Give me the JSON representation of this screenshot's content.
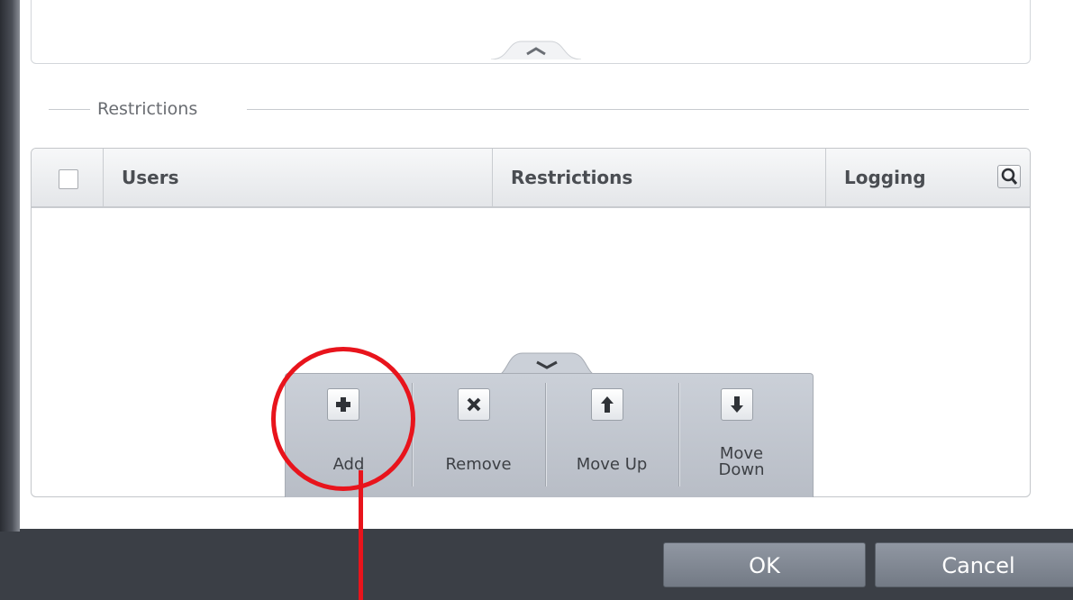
{
  "section": {
    "label": "Restrictions"
  },
  "table": {
    "columns": [
      "Users",
      "Restrictions",
      "Logging"
    ],
    "rows": []
  },
  "toolbar": {
    "items": [
      {
        "label": "Add",
        "icon": "plus-icon"
      },
      {
        "label": "Remove",
        "icon": "x-icon"
      },
      {
        "label": "Move Up",
        "icon": "arrow-up-icon"
      },
      {
        "label": "Move",
        "label2": "Down",
        "icon": "arrow-down-icon"
      }
    ]
  },
  "footer": {
    "ok_label": "OK",
    "cancel_label": "Cancel"
  },
  "colors": {
    "annotation": "#e8141c",
    "footer_bg": "#3b3f46"
  }
}
